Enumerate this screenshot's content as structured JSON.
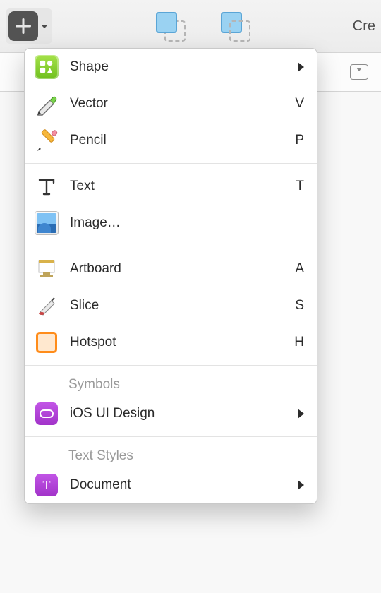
{
  "toolbar": {
    "right_label_partial": "Cre"
  },
  "menu": {
    "items_main": [
      {
        "label": "Shape",
        "shortcut": "",
        "submenu": true,
        "icon": "shape-icon"
      },
      {
        "label": "Vector",
        "shortcut": "V",
        "submenu": false,
        "icon": "vector-icon"
      },
      {
        "label": "Pencil",
        "shortcut": "P",
        "submenu": false,
        "icon": "pencil-icon"
      }
    ],
    "items_media": [
      {
        "label": "Text",
        "shortcut": "T",
        "submenu": false,
        "icon": "text-icon"
      },
      {
        "label": "Image…",
        "shortcut": "",
        "submenu": false,
        "icon": "image-icon"
      }
    ],
    "items_layout": [
      {
        "label": "Artboard",
        "shortcut": "A",
        "submenu": false,
        "icon": "artboard-icon"
      },
      {
        "label": "Slice",
        "shortcut": "S",
        "submenu": false,
        "icon": "slice-icon"
      },
      {
        "label": "Hotspot",
        "shortcut": "H",
        "submenu": false,
        "icon": "hotspot-icon"
      }
    ],
    "symbols_header": "Symbols",
    "symbols_items": [
      {
        "label": "iOS UI Design",
        "submenu": true,
        "icon": "symbol-icon"
      }
    ],
    "textstyles_header": "Text Styles",
    "textstyles_items": [
      {
        "label": "Document",
        "submenu": true,
        "icon": "textstyle-icon"
      }
    ]
  }
}
